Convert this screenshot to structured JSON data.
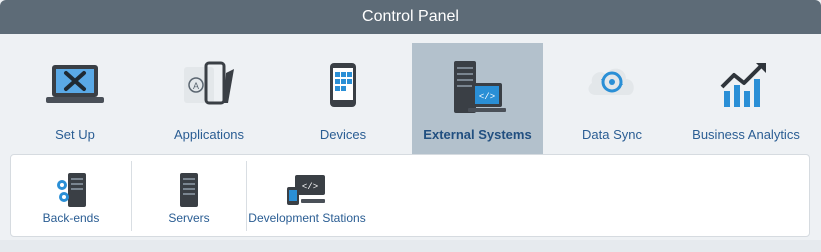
{
  "header": {
    "title": "Control Panel"
  },
  "nav": {
    "items": [
      {
        "label": "Set Up",
        "icon": "laptop-tools-icon"
      },
      {
        "label": "Applications",
        "icon": "app-phone-icon"
      },
      {
        "label": "Devices",
        "icon": "smartphone-icon"
      },
      {
        "label": "External Systems",
        "icon": "server-monitor-icon",
        "active": true
      },
      {
        "label": "Data Sync",
        "icon": "cloud-sync-icon"
      },
      {
        "label": "Business Analytics",
        "icon": "trending-chart-icon"
      }
    ]
  },
  "subnav": {
    "items": [
      {
        "label": "Back-ends",
        "icon": "server-gear-icon"
      },
      {
        "label": "Servers",
        "icon": "server-icon"
      },
      {
        "label": "Development Stations",
        "icon": "dev-station-icon"
      }
    ]
  },
  "colors": {
    "header_bg": "#5d6b77",
    "accent_blue": "#2a8fd6",
    "active_bg": "#b3c1cc",
    "label_blue": "#2a5d93"
  }
}
